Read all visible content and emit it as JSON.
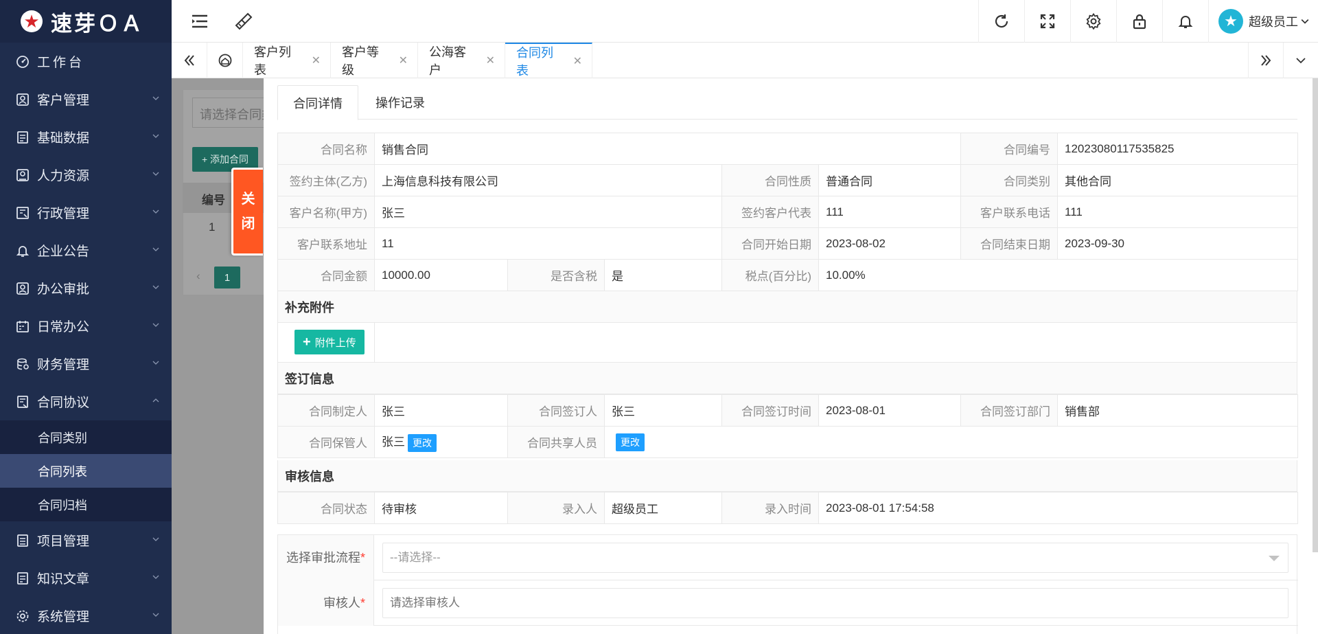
{
  "app": {
    "logo_text": "速芽ＯＡ"
  },
  "sidebar": {
    "items": [
      {
        "label": "工作台",
        "icon": "dashboard-icon"
      },
      {
        "label": "客户管理",
        "icon": "customer-icon"
      },
      {
        "label": "基础数据",
        "icon": "database-icon"
      },
      {
        "label": "人力资源",
        "icon": "hr-icon"
      },
      {
        "label": "行政管理",
        "icon": "admin-icon"
      },
      {
        "label": "企业公告",
        "icon": "bell-icon"
      },
      {
        "label": "办公审批",
        "icon": "approval-icon"
      },
      {
        "label": "日常办公",
        "icon": "calendar-icon"
      },
      {
        "label": "财务管理",
        "icon": "finance-icon"
      },
      {
        "label": "合同协议",
        "icon": "contract-icon"
      },
      {
        "label": "项目管理",
        "icon": "project-icon"
      },
      {
        "label": "知识文章",
        "icon": "article-icon"
      },
      {
        "label": "系统管理",
        "icon": "settings-icon"
      }
    ],
    "sub_items": [
      "合同类别",
      "合同列表",
      "合同归档"
    ]
  },
  "header": {
    "user_name": "超级员工"
  },
  "tabs": [
    {
      "label": "客户列表"
    },
    {
      "label": "客户等级"
    },
    {
      "label": "公海客户"
    },
    {
      "label": "合同列表"
    }
  ],
  "background": {
    "search_placeholder": "请选择合同类",
    "add_button": "+ 添加合同",
    "col_header": "编号",
    "row_value": "1",
    "page": "1"
  },
  "close_label": [
    "关",
    "闭"
  ],
  "drawer": {
    "tabs": [
      "合同详情",
      "操作记录"
    ],
    "detail": {
      "contract_name_label": "合同名称",
      "contract_name": "销售合同",
      "contract_no_label": "合同编号",
      "contract_no": "12023080117535825",
      "party_b_label": "签约主体(乙方)",
      "party_b": "上海信息科技有限公司",
      "nature_label": "合同性质",
      "nature": "普通合同",
      "category_label": "合同类别",
      "category": "其他合同",
      "customer_label": "客户名称(甲方)",
      "customer": "张三",
      "rep_label": "签约客户代表",
      "rep": "111",
      "phone_label": "客户联系电话",
      "phone": "111",
      "address_label": "客户联系地址",
      "address": "11",
      "start_label": "合同开始日期",
      "start": "2023-08-02",
      "end_label": "合同结束日期",
      "end": "2023-09-30",
      "amount_label": "合同金额",
      "amount": "10000.00",
      "tax_inc_label": "是否含税",
      "tax_inc": "是",
      "tax_rate_label": "税点(百分比)",
      "tax_rate": "10.00%"
    },
    "attachments": {
      "title": "补充附件",
      "upload_label": "附件上传"
    },
    "signing": {
      "title": "签订信息",
      "maker_label": "合同制定人",
      "maker": "张三",
      "signer_label": "合同签订人",
      "signer": "张三",
      "sign_time_label": "合同签订时间",
      "sign_time": "2023-08-01",
      "dept_label": "合同签订部门",
      "dept": "销售部",
      "keeper_label": "合同保管人",
      "keeper": "张三",
      "share_label": "合同共享人员",
      "change_label": "更改"
    },
    "audit": {
      "title": "审核信息",
      "status_label": "合同状态",
      "status": "待审核",
      "entry_label": "录入人",
      "entry": "超级员工",
      "entry_time_label": "录入时间",
      "entry_time": "2023-08-01 17:54:58"
    },
    "form": {
      "flow_label": "选择审批流程",
      "flow_value": "--请选择--",
      "reviewer_label": "审核人",
      "reviewer_placeholder": "请选择审核人",
      "required_mark": "*"
    }
  },
  "colors": {
    "sidebar_bg": "#1f2d4d",
    "accent": "#1e88e5",
    "teal": "#16b8a2",
    "close": "#ff5722"
  }
}
